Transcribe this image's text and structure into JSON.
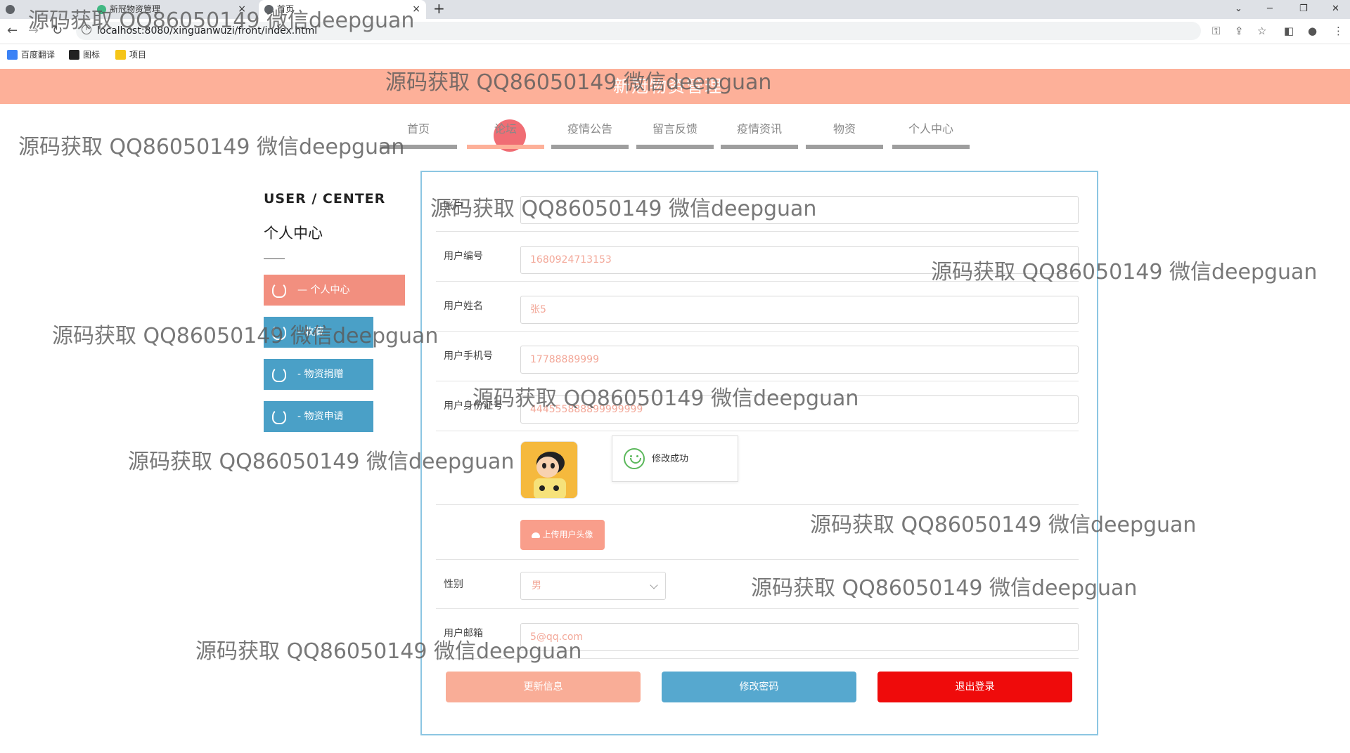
{
  "browser": {
    "tabs": [
      {
        "title": "新冠物资管理",
        "close": "×"
      },
      {
        "title": "首页",
        "close": "×"
      }
    ],
    "new_tab": "+",
    "url": "localhost:8080/xinguanwuzi/front/index.html",
    "bookmarks": [
      {
        "label": "百度翻译",
        "color": "#3b82f6"
      },
      {
        "label": "图标",
        "color": "#222222"
      },
      {
        "label": "项目",
        "color": "#f5c518"
      }
    ]
  },
  "site": {
    "title": "新冠物资管理",
    "nav": [
      {
        "label": "首页"
      },
      {
        "label": "论坛"
      },
      {
        "label": "疫情公告"
      },
      {
        "label": "留言反馈"
      },
      {
        "label": "疫情资讯"
      },
      {
        "label": "物资"
      },
      {
        "label": "个人中心"
      }
    ],
    "active_nav": "论坛"
  },
  "sidebar": {
    "heading": "USER / CENTER",
    "subheading": "个人中心",
    "items": [
      {
        "label": "— 个人中心"
      },
      {
        "label": "- 收藏"
      },
      {
        "label": "- 物资捐赠"
      },
      {
        "label": "- 物资申请"
      }
    ]
  },
  "form": {
    "fields": [
      {
        "label": "账户",
        "value": ""
      },
      {
        "label": "用户编号",
        "value": "1680924713153"
      },
      {
        "label": "用户姓名",
        "value": "张5"
      },
      {
        "label": "用户手机号",
        "value": "17788889999"
      },
      {
        "label": "用户身份证号",
        "value": "444555888899999999"
      }
    ],
    "toast": "修改成功",
    "upload_label": "上传用户头像",
    "gender": {
      "label": "性别",
      "value": "男"
    },
    "email": {
      "label": "用户邮箱",
      "value": "5@qq.com"
    },
    "buttons": {
      "update": "更新信息",
      "change_password": "修改密码",
      "logout": "退出登录"
    }
  },
  "watermark": "源码获取 QQ86050149 微信deepguan",
  "colors": {
    "header": "#fdb099",
    "sidebar_active": "#f28f7f",
    "sidebar_item": "#4aa0c7",
    "logout": "#ef0b0b",
    "update": "#f9ad97",
    "password": "#56a8cf"
  }
}
